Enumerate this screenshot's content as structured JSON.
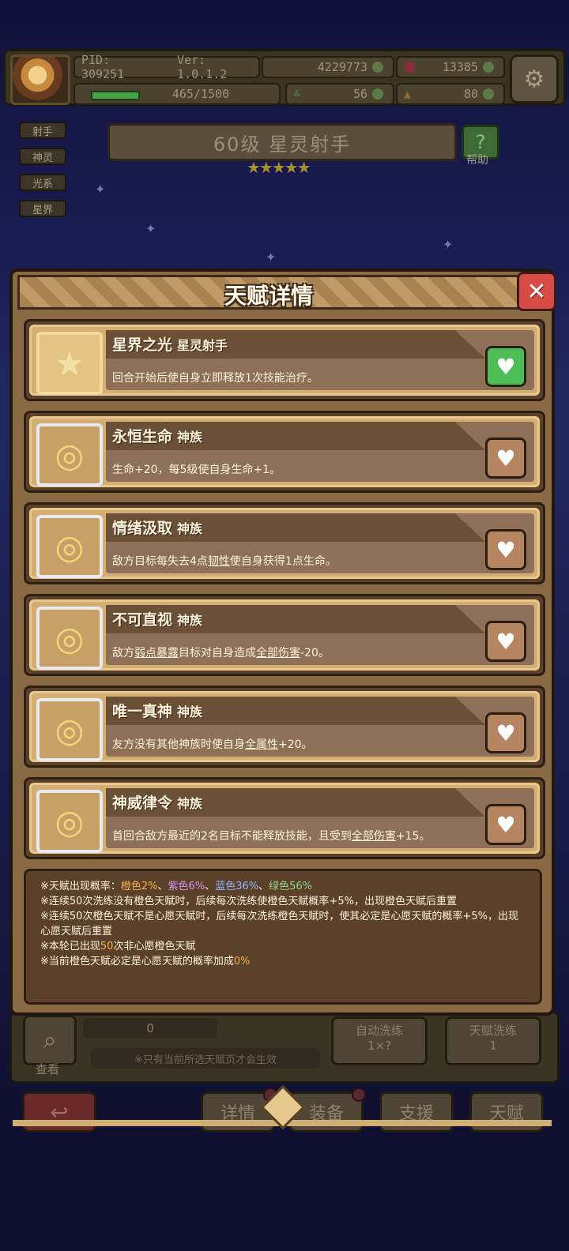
{
  "header": {
    "pid": "PID: 309251",
    "version": "Ver: 1.0.1.2",
    "gold": "4229773",
    "gems": "13385",
    "energy": "465/1500",
    "clover": "56",
    "boots": "80"
  },
  "hero": {
    "tags": [
      "射手",
      "神灵",
      "光系",
      "星界"
    ],
    "title": "60级 星灵射手",
    "stars": "★★★★★",
    "help_label": "帮助"
  },
  "modal": {
    "title": "天赋详情",
    "close": "✕",
    "talents": [
      {
        "name": "星界之光",
        "category": "星灵射手",
        "desc": "回合开始后使自身立即释放1次技能治疗。",
        "style": "gold",
        "state": "green"
      },
      {
        "name": "永恒生命",
        "category": "神族",
        "desc": "生命+20，每5级使自身生命+1。",
        "style": "silver",
        "state": "brown"
      },
      {
        "name": "情绪汲取",
        "category": "神族",
        "desc_pre": "敌方目标每失去4点",
        "desc_u": "韧性",
        "desc_post": "使自身获得1点生命。",
        "style": "silver",
        "state": "brown"
      },
      {
        "name": "不可直视",
        "category": "神族",
        "desc_pre": "敌方",
        "desc_u": "弱点暴露",
        "desc_mid": "目标对自身造成",
        "desc_u2": "全部伤害",
        "desc_post": "-20。",
        "style": "silver",
        "state": "brown"
      },
      {
        "name": "唯一真神",
        "category": "神族",
        "desc_pre": "友方没有其他神族时使自身",
        "desc_u": "全属性",
        "desc_post": "+20。",
        "style": "silver",
        "state": "brown"
      },
      {
        "name": "神威律令",
        "category": "神族",
        "desc_pre": "首回合敌方最近的2名目标不能释放技能，且受到",
        "desc_u": "全部伤害",
        "desc_post": "+15。",
        "style": "silver",
        "state": "brown"
      }
    ],
    "info": {
      "line1_label": "※天赋出现概率：",
      "orange": "橙色2%",
      "purple": "紫色6%",
      "blue": "蓝色36%",
      "green": "绿色56%",
      "sep": "、",
      "line2": "※连续50次洗练没有橙色天赋时，后续每次洗练使橙色天赋概率+5%，出现橙色天赋后重置",
      "line3": "※连续50次橙色天赋不是心愿天赋时，后续每次洗练橙色天赋时，使其必定是心愿天赋的概率+5%，出现心愿天赋后重置",
      "line4_pre": "※本轮已出现",
      "line4_num": "50",
      "line4_post": "次非心愿橙色天赋",
      "line5_pre": "※当前橙色天赋必定是心愿天赋的概率加成",
      "line5_num": "0%"
    }
  },
  "bottom": {
    "view_label": "查看",
    "count": "0",
    "hint": "※只有当前所选天赋页才会生效",
    "auto_label": "自动洗练",
    "auto_count": "1×?",
    "talent_wash_label": "天赋洗练",
    "talent_wash_count": "1",
    "nav": [
      "详情",
      "装备",
      "支援",
      "天赋"
    ]
  }
}
